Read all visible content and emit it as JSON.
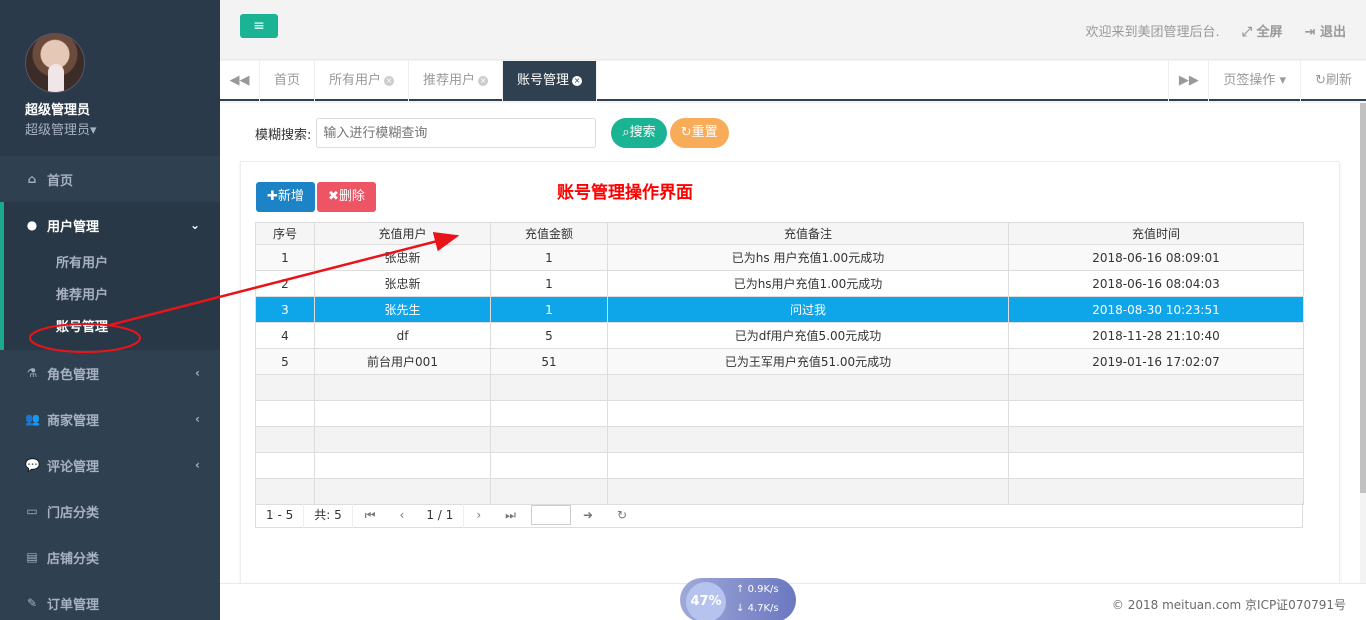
{
  "profile": {
    "name": "超级管理员",
    "role": "超级管理员▾"
  },
  "sidebar": {
    "items": [
      {
        "icon": "home-icon",
        "label": "首页"
      },
      {
        "icon": "user-icon",
        "label": "用户管理"
      },
      {
        "icon": "flask-icon",
        "label": "角色管理"
      },
      {
        "icon": "users-icon",
        "label": "商家管理"
      },
      {
        "icon": "comment-icon",
        "label": "评论管理"
      },
      {
        "icon": "desktop-icon",
        "label": "门店分类"
      },
      {
        "icon": "file-icon",
        "label": "店铺分类"
      },
      {
        "icon": "edit-icon",
        "label": "订单管理"
      }
    ],
    "sub_items": [
      {
        "label": "所有用户"
      },
      {
        "label": "推荐用户"
      },
      {
        "label": "账号管理"
      }
    ]
  },
  "topbar": {
    "welcome": "欢迎来到美团管理后台.",
    "fullscreen": "全屏",
    "logout": "退出"
  },
  "tabs": [
    {
      "label": "首页",
      "closable": false
    },
    {
      "label": "所有用户",
      "closable": true
    },
    {
      "label": "推荐用户",
      "closable": true
    },
    {
      "label": "账号管理",
      "closable": true,
      "active": true
    }
  ],
  "tab_actions": {
    "page_ops": "页签操作",
    "refresh": "刷新"
  },
  "search": {
    "label": "模糊搜索:",
    "placeholder": "输入进行模糊查询",
    "search_btn": "搜索",
    "reset_btn": "重置"
  },
  "toolbar": {
    "add": "新增",
    "delete": "删除"
  },
  "annotation": "账号管理操作界面",
  "table": {
    "columns": [
      "序号",
      "充值用户",
      "充值金额",
      "充值备注",
      "充值时间"
    ],
    "rows": [
      [
        "1",
        "张忠新",
        "1",
        "已为hs 用户充值1.00元成功",
        "2018-06-16 08:09:01"
      ],
      [
        "2",
        "张忠新",
        "1",
        "已为hs用户充值1.00元成功",
        "2018-06-16 08:04:03"
      ],
      [
        "3",
        "张先生",
        "1",
        "问过我",
        "2018-08-30 10:23:51"
      ],
      [
        "4",
        "df",
        "5",
        "已为df用户充值5.00元成功",
        "2018-11-28 21:10:40"
      ],
      [
        "5",
        "前台用户001",
        "51",
        "已为王军用户充值51.00元成功",
        "2019-01-16 17:02:07"
      ]
    ],
    "selected_row": 3
  },
  "pager": {
    "range": "1 - 5",
    "total": "共: 5",
    "page": "1 / 1"
  },
  "footer": {
    "copyright": "© 2018 meituan.com 京ICP证070791号"
  },
  "speed_widget": {
    "percent": "47%",
    "up": "0.9K/s",
    "down": "4.7K/s"
  }
}
